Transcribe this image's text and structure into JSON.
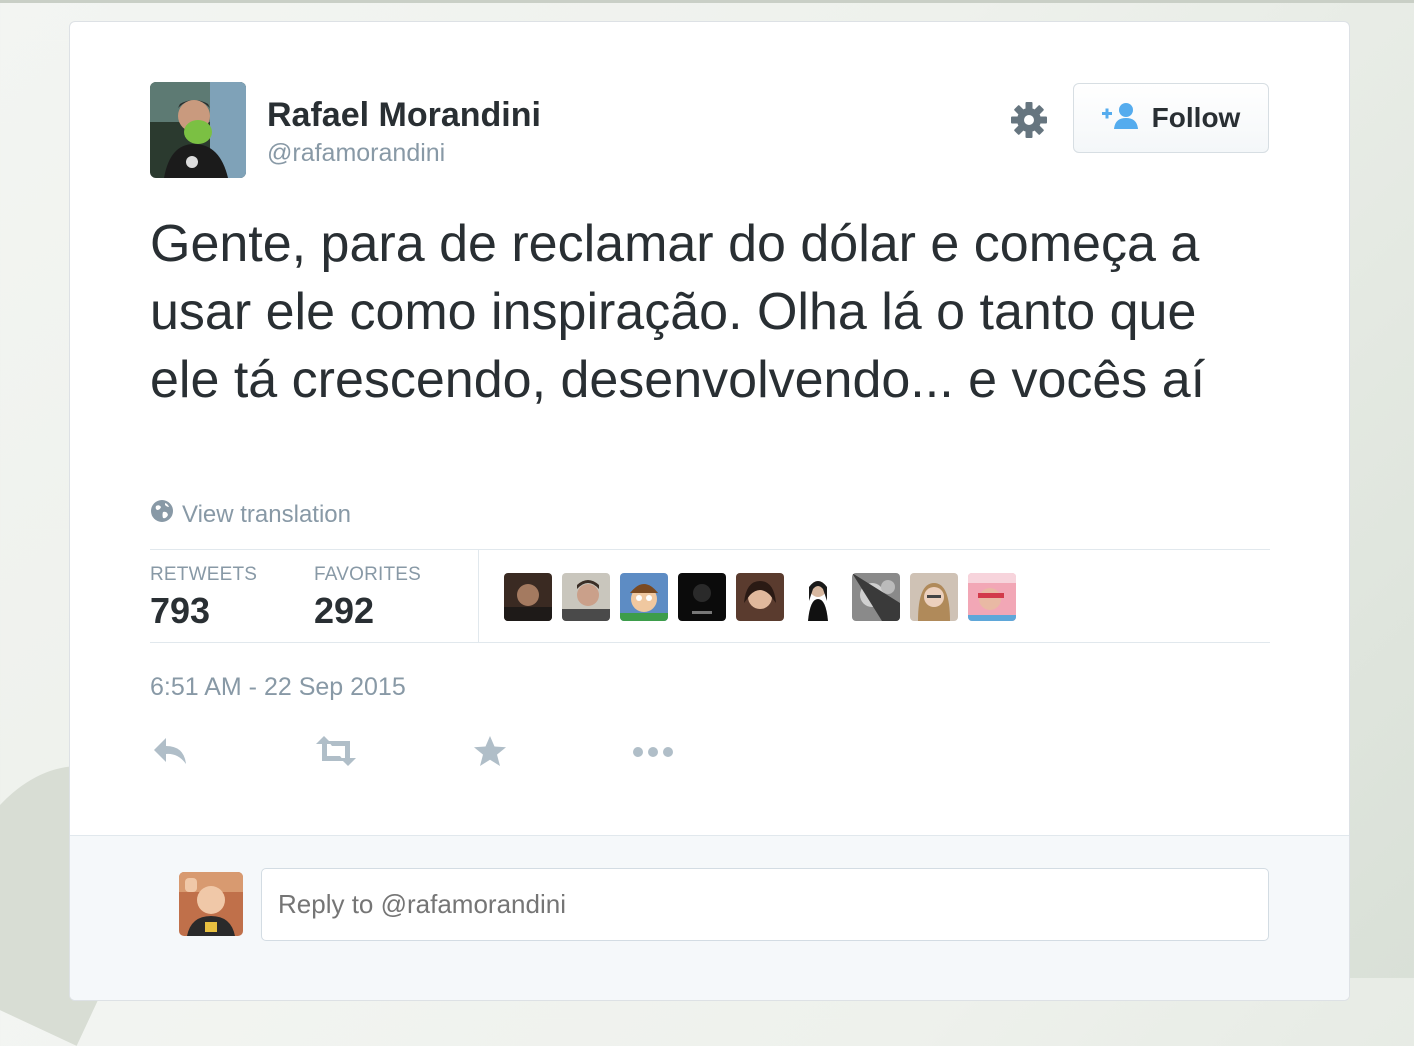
{
  "user": {
    "display_name": "Rafael Morandini",
    "username": "@rafamorandini"
  },
  "header": {
    "follow_label": "Follow"
  },
  "tweet": {
    "text": "Gente, para de reclamar do dólar e começa a usar ele como inspiração. Olha lá o tanto que ele tá crescendo, desenvolvendo... e vocês aí",
    "view_translation": "View translation",
    "timestamp": "6:51 AM - 22 Sep 2015"
  },
  "stats": {
    "retweets_label": "RETWEETS",
    "retweets_value": "793",
    "favorites_label": "FAVORITES",
    "favorites_value": "292",
    "favoriter_count_shown": 9
  },
  "reply": {
    "placeholder": "Reply to @rafamorandini"
  },
  "icons": {
    "gear": "gear-icon",
    "follow": "add-user-icon",
    "globe": "globe-icon",
    "reply": "reply-icon",
    "retweet": "retweet-icon",
    "favorite": "star-icon",
    "more": "more-icon"
  },
  "colors": {
    "text": "#292f33",
    "muted": "#8899a6",
    "accent": "#55acee",
    "border": "#e1e8ed"
  }
}
